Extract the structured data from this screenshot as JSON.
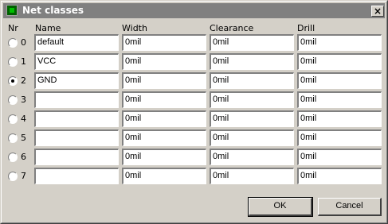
{
  "window": {
    "title": "Net classes"
  },
  "headers": {
    "nr": "Nr",
    "name": "Name",
    "width": "Width",
    "clearance": "Clearance",
    "drill": "Drill"
  },
  "rows": [
    {
      "nr": "0",
      "name": "default",
      "width": "0mil",
      "clearance": "0mil",
      "drill": "0mil",
      "selected": false
    },
    {
      "nr": "1",
      "name": "VCC",
      "width": "0mil",
      "clearance": "0mil",
      "drill": "0mil",
      "selected": false
    },
    {
      "nr": "2",
      "name": "GND",
      "width": "0mil",
      "clearance": "0mil",
      "drill": "0mil",
      "selected": true
    },
    {
      "nr": "3",
      "name": "",
      "width": "0mil",
      "clearance": "0mil",
      "drill": "0mil",
      "selected": false
    },
    {
      "nr": "4",
      "name": "",
      "width": "0mil",
      "clearance": "0mil",
      "drill": "0mil",
      "selected": false
    },
    {
      "nr": "5",
      "name": "",
      "width": "0mil",
      "clearance": "0mil",
      "drill": "0mil",
      "selected": false
    },
    {
      "nr": "6",
      "name": "",
      "width": "0mil",
      "clearance": "0mil",
      "drill": "0mil",
      "selected": false
    },
    {
      "nr": "7",
      "name": "",
      "width": "0mil",
      "clearance": "0mil",
      "drill": "0mil",
      "selected": false
    }
  ],
  "buttons": {
    "ok": "OK",
    "cancel": "Cancel"
  }
}
